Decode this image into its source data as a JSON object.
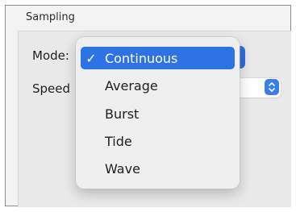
{
  "section": {
    "title": "Sampling"
  },
  "mode": {
    "label": "Mode:",
    "selected": "Continuous",
    "options": [
      {
        "label": "Continuous",
        "checked": true,
        "check_mark": "✓"
      },
      {
        "label": "Average",
        "checked": false
      },
      {
        "label": "Burst",
        "checked": false
      },
      {
        "label": "Tide",
        "checked": false
      },
      {
        "label": "Wave",
        "checked": false
      }
    ]
  },
  "speed": {
    "label": "Speed"
  },
  "colors": {
    "selection": "#2e73e6",
    "stepper": "#3a7ee8",
    "menu_background": "#efefef"
  },
  "icons": {
    "stepper": "chevron-up-down-icon",
    "check": "checkmark-icon"
  }
}
